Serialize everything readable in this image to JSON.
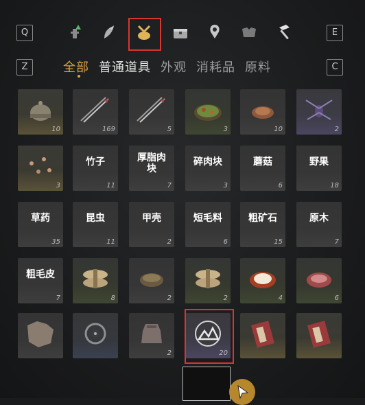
{
  "keys": {
    "prev_category": "Q",
    "next_category": "E",
    "prev_tab": "Z",
    "next_tab": "C"
  },
  "categories": [
    {
      "icon": "character-icon",
      "selected": false
    },
    {
      "icon": "feather-icon",
      "selected": false
    },
    {
      "icon": "pouch-icon",
      "selected": true
    },
    {
      "icon": "chest-icon",
      "selected": false
    },
    {
      "icon": "map-pin-icon",
      "selected": false
    },
    {
      "icon": "cloth-icon",
      "selected": false
    },
    {
      "icon": "hammer-icon",
      "selected": false
    }
  ],
  "subtabs": [
    {
      "label": "全部",
      "active": true
    },
    {
      "label": "普通道具",
      "active": false
    },
    {
      "label": "外观",
      "active": false
    },
    {
      "label": "消耗品",
      "active": false
    },
    {
      "label": "原料",
      "active": false
    }
  ],
  "items": [
    {
      "icon": "helmet-icon",
      "qty": "10",
      "rarity": "gold"
    },
    {
      "icon": "arrow-icon",
      "qty": "169",
      "rarity": "gray"
    },
    {
      "icon": "arrow-icon",
      "qty": "5",
      "rarity": "gray"
    },
    {
      "icon": "stirfry-dish-icon",
      "qty": "3",
      "rarity": "green"
    },
    {
      "icon": "roast-meat-icon",
      "qty": "10",
      "rarity": "gray"
    },
    {
      "icon": "insect-icon",
      "qty": "2",
      "rarity": "purple"
    },
    {
      "icon": "small-creatures-icon",
      "qty": "3",
      "rarity": "gold"
    },
    {
      "name": "竹子",
      "qty": "11",
      "rarity": "gray"
    },
    {
      "name": "厚脂肉块",
      "qty": "7",
      "rarity": "gray"
    },
    {
      "name": "碎肉块",
      "qty": "3",
      "rarity": "gray"
    },
    {
      "name": "蘑菇",
      "qty": "6",
      "rarity": "gray"
    },
    {
      "name": "野果",
      "qty": "18",
      "rarity": "gray"
    },
    {
      "name": "草药",
      "qty": "35",
      "rarity": "gray"
    },
    {
      "name": "昆虫",
      "qty": "11",
      "rarity": "gray"
    },
    {
      "name": "甲壳",
      "qty": "2",
      "rarity": "gray"
    },
    {
      "name": "短毛料",
      "qty": "6",
      "rarity": "gray"
    },
    {
      "name": "粗矿石",
      "qty": "15",
      "rarity": "gray"
    },
    {
      "name": "原木",
      "qty": "7",
      "rarity": "gray"
    },
    {
      "name": "粗毛皮",
      "qty": "7",
      "rarity": "gray"
    },
    {
      "icon": "rice-bundle-icon",
      "qty": "8",
      "rarity": "green"
    },
    {
      "icon": "herb-bowl-icon",
      "qty": "2",
      "rarity": "gray"
    },
    {
      "icon": "rice-bundle-icon",
      "qty": "2",
      "rarity": "green"
    },
    {
      "icon": "egg-dish-icon",
      "qty": "4",
      "rarity": "green"
    },
    {
      "icon": "steak-icon",
      "qty": "6",
      "rarity": "green"
    },
    {
      "icon": "pelt-icon",
      "qty": "",
      "rarity": "gray"
    },
    {
      "icon": "bead-net-icon",
      "qty": "",
      "rarity": "blue"
    },
    {
      "icon": "cloth-pouch-icon",
      "qty": "2",
      "rarity": "gray"
    },
    {
      "icon": "mountain-emblem-icon",
      "qty": "20",
      "rarity": "purple",
      "selected": true
    },
    {
      "icon": "red-book-icon",
      "qty": "",
      "rarity": "gold"
    },
    {
      "icon": "red-book-icon",
      "qty": "",
      "rarity": "gold"
    }
  ],
  "colors": {
    "accent": "#d9a44a",
    "highlight": "#d8362f"
  }
}
